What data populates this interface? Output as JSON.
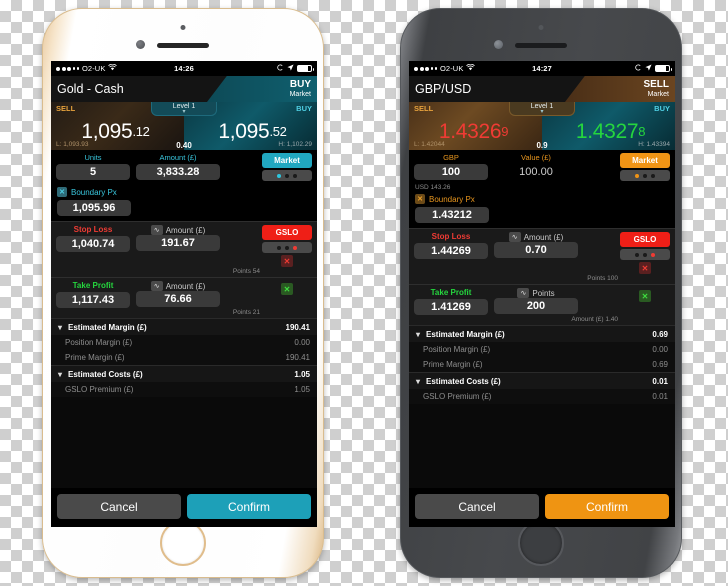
{
  "phones": [
    {
      "id": "left",
      "shell": "white-gold",
      "accent": "#21a7c0",
      "statusbar": {
        "carrier": "O2-UK",
        "time": "14:26",
        "wifi_icon": "wifi-icon",
        "lock_icon": "rotation-lock-icon",
        "location_icon": "location-arrow-icon",
        "battery_icon": "battery-icon"
      },
      "title": {
        "instrument": "Gold - Cash",
        "direction": "BUY",
        "order_type": "Market"
      },
      "price": {
        "sell_label": "SELL",
        "buy_label": "BUY",
        "level_label": "Level 1",
        "sell_big": "1,095",
        "sell_small": ".12",
        "buy_big": "1,095",
        "buy_small": ".52",
        "low": "L: 1,093.93",
        "high": "H: 1,102.29",
        "spread": "0.40"
      },
      "amount": {
        "qty_label": "Units",
        "qty_value": "5",
        "val_label": "Amount (£)",
        "val_value": "3,833.28",
        "subnote": "",
        "market_label": "Market"
      },
      "boundary": {
        "label": "Boundary Px",
        "value": "1,095.96",
        "check_icon": "x-checkbox-icon"
      },
      "stop_loss": {
        "label": "Stop Loss",
        "price": "1,040.74",
        "second_label": "Amount (£)",
        "second_value": "191.67",
        "note": "Points 54",
        "gslo_label": "GSLO",
        "chart_icon": "trend-wave-icon"
      },
      "take_profit": {
        "label": "Take Profit",
        "price": "1,117.43",
        "second_label": "Amount (£)",
        "second_value": "76.66",
        "note": "Points 21",
        "chart_icon": "trend-wave-icon"
      },
      "summary": [
        {
          "type": "head",
          "label": "Estimated Margin (£)",
          "value": "190.41"
        },
        {
          "type": "sub",
          "label": "Position Margin (£)",
          "value": "0.00"
        },
        {
          "type": "sub",
          "label": "Prime Margin (£)",
          "value": "190.41"
        },
        {
          "type": "head",
          "label": "Estimated Costs (£)",
          "value": "1.05"
        },
        {
          "type": "sub",
          "label": "GSLO Premium (£)",
          "value": "1.05"
        }
      ],
      "footer": {
        "cancel": "Cancel",
        "confirm": "Confirm"
      }
    },
    {
      "id": "right",
      "shell": "space-gray",
      "accent": "#f09415",
      "statusbar": {
        "carrier": "O2-UK",
        "time": "14:27",
        "wifi_icon": "wifi-icon",
        "lock_icon": "rotation-lock-icon",
        "location_icon": "location-arrow-icon",
        "battery_icon": "battery-icon"
      },
      "title": {
        "instrument": "GBP/USD",
        "direction": "SELL",
        "order_type": "Market"
      },
      "price": {
        "sell_label": "SELL",
        "buy_label": "BUY",
        "level_label": "Level 1",
        "sell_big": "1.4326",
        "sell_small": "9",
        "buy_big": "1.4327",
        "buy_small": "8",
        "low": "L: 1.42044",
        "high": "H: 1.43394",
        "spread": "0.9"
      },
      "amount": {
        "qty_label": "GBP",
        "qty_value": "100",
        "val_label": "Value (£)",
        "val_value": "100.00",
        "subnote": "USD 143.26",
        "market_label": "Market"
      },
      "boundary": {
        "label": "Boundary Px",
        "value": "1.43212",
        "check_icon": "x-checkbox-icon"
      },
      "stop_loss": {
        "label": "Stop Loss",
        "price": "1.44269",
        "second_label": "Amount (£)",
        "second_value": "0.70",
        "note": "Points 100",
        "gslo_label": "GSLO",
        "chart_icon": "trend-wave-icon"
      },
      "take_profit": {
        "label": "Take Profit",
        "price": "1.41269",
        "second_label": "Points",
        "second_value": "200",
        "note": "Amount (£) 1.40",
        "chart_icon": "trend-wave-icon"
      },
      "summary": [
        {
          "type": "head",
          "label": "Estimated Margin (£)",
          "value": "0.69"
        },
        {
          "type": "sub",
          "label": "Position Margin (£)",
          "value": "0.00"
        },
        {
          "type": "sub",
          "label": "Prime Margin (£)",
          "value": "0.69"
        },
        {
          "type": "head",
          "label": "Estimated Costs (£)",
          "value": "0.01"
        },
        {
          "type": "sub",
          "label": "GSLO Premium (£)",
          "value": "0.01"
        }
      ],
      "footer": {
        "cancel": "Cancel",
        "confirm": "Confirm"
      }
    }
  ]
}
